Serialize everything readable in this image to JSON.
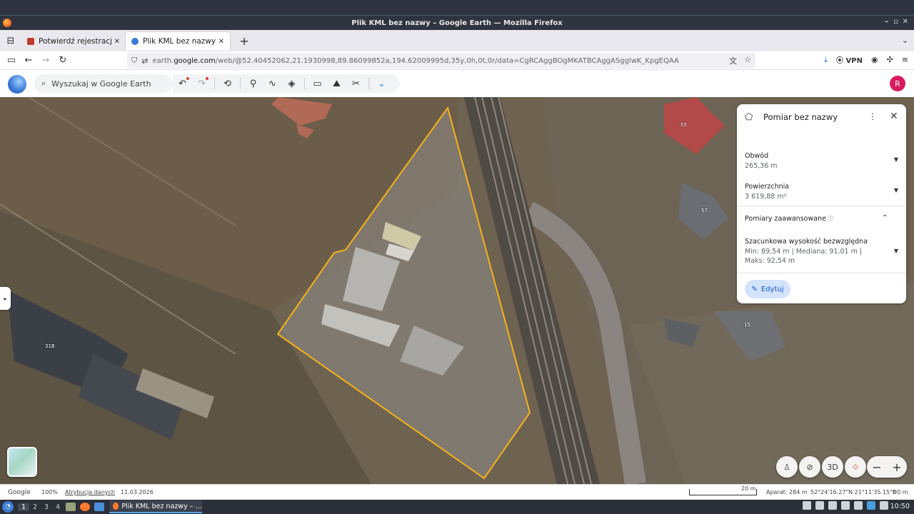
{
  "window": {
    "title": "Plik KML bez nazwy – Google Earth — Mozilla Firefox",
    "minimize": "–",
    "restore": "▫",
    "close": "✕"
  },
  "tabs": [
    {
      "label": "Potwierdź rejestrację w A",
      "close": "✕",
      "favicon_color": "#c0392b"
    },
    {
      "label": "Plik KML bez nazwy – Goo",
      "close": "✕",
      "favicon_color": "#3d7bd9",
      "active": true
    }
  ],
  "tabbar": {
    "new_tab": "+",
    "overflow": "⌄"
  },
  "urlbar": {
    "url_prefix": "earth.",
    "url_domain": "google.com",
    "url_path": "/web/@52.40452062,21.1930998,89.86099852a,194.62009995d,35y,0h,0t,0r/data=CgRCAggBOgMKATBCAggASgglwK_KpgEQAA"
  },
  "navbar": {
    "vpn_label": "VPN"
  },
  "earth_toolbar": {
    "search_placeholder": "Wyszukaj w Google Earth",
    "user_initial": "R"
  },
  "map": {
    "house_numbers": [
      "55",
      "57",
      "15",
      "31B"
    ]
  },
  "panel": {
    "title": "Pomiar bez nazwy",
    "perimeter_label": "Obwód",
    "perimeter_value": "265,36 m",
    "area_label": "Powierzchnia",
    "area_value": "3 619,88 m²",
    "advanced_label": "Pomiary zaawansowane",
    "elevation_label": "Szacunkowa wysokość bezwzględna",
    "elevation_value_1": "Min: 89,54 m | Mediana: 91,01 m |",
    "elevation_value_2": "Maks: 92,54 m",
    "edit_label": "Edytuj"
  },
  "map_controls": {
    "three_d": "3D",
    "zoom_out": "−",
    "zoom_in": "+"
  },
  "statusbar": {
    "brand": "Google",
    "zoom": "100%",
    "attribution": "Atrybucja danych",
    "date": "11.03.2026",
    "scale": "20 m",
    "camera": "Aparat: 284 m",
    "coords": "52°24'16.27\"N 21°11'35.15\"E",
    "altitude": "90 m"
  },
  "taskbar": {
    "workspaces": [
      "1",
      "2",
      "3",
      "4"
    ],
    "task_label": "Plik KML bez nazwy – …",
    "clock": "10:50"
  },
  "colors": {
    "polygon_outline": "#f5b21b",
    "accent": "#1a73e8",
    "avatar": "#d81b60"
  }
}
